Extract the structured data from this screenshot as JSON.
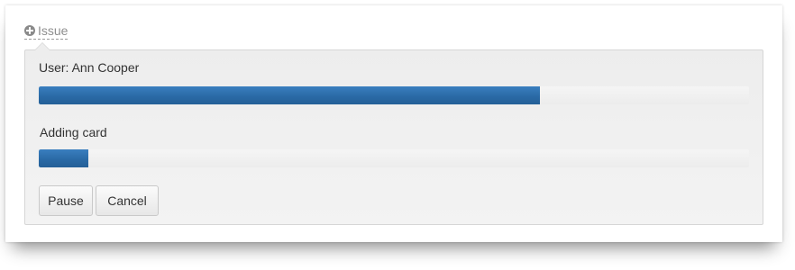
{
  "issue_toggle": {
    "label": "Issue",
    "icon": "plus-circle-icon"
  },
  "tasks": [
    {
      "label": "User: Ann Cooper",
      "progress_fraction": 0.705
    },
    {
      "label": "Adding card",
      "progress_fraction": 0.07
    }
  ],
  "buttons": {
    "pause": "Pause",
    "cancel": "Cancel"
  },
  "colors": {
    "progress_fill": "#2a6aa6",
    "panel_background": "#ededed"
  }
}
